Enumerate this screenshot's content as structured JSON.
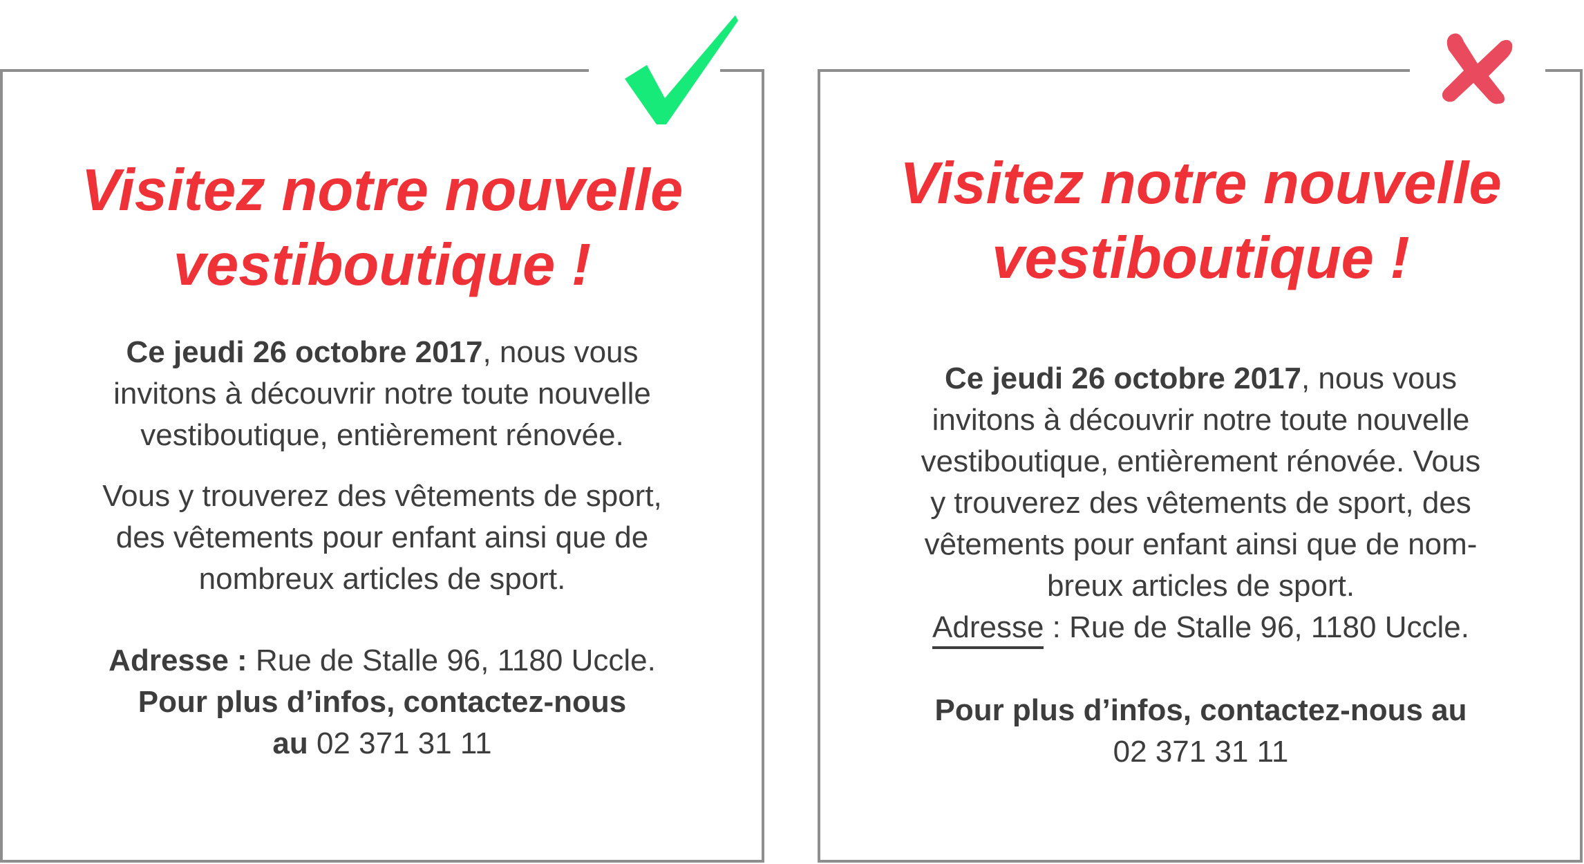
{
  "good_example": {
    "headline_line1": "Visitez notre nouvelle",
    "headline_line2": "vestiboutique !",
    "date_bold": "Ce jeudi 26 octobre 2017",
    "para1_rest": ", nous vous",
    "para1_line2": "invitons à découvrir notre toute nouvelle",
    "para1_line3": "vestiboutique, entièrement rénovée.",
    "para2_line1": "Vous y trouverez des vêtements de sport,",
    "para2_line2": "des vêtements pour enfant ainsi que de",
    "para2_line3": "nombreux articles de sport.",
    "address_label": "Adresse :",
    "address_value": " Rue de Stalle 96, 1180 Uccle.",
    "contact_line1": "Pour plus d’infos, contactez-nous",
    "contact_au": "au",
    "contact_phone": " 02 371 31 11"
  },
  "bad_example": {
    "headline_line1": "Visitez notre nouvelle",
    "headline_line2": "vestiboutique !",
    "date_bold": "Ce jeudi 26 octobre 2017",
    "para1_rest": ", nous vous",
    "line2": "invitons à découvrir notre toute nouvelle",
    "line3": "vestiboutique, entièrement rénovée. Vous",
    "line4": "y trouverez des vêtements de sport, des",
    "line5": "vêtements pour enfant ainsi que de nom-",
    "line6": "breux articles de sport.",
    "address_label": "Adresse",
    "address_value": " : Rue de Stalle 96, 1180 Uccle.",
    "contact_line1": "Pour plus d’infos, contactez-nous au",
    "contact_phone": "02 371 31 11"
  },
  "colors": {
    "headline": "#ee3238",
    "body": "#3d3d3d",
    "check": "#18ea7a",
    "cross": "#ea4a5e",
    "border": "#8e8e8e"
  },
  "icons": {
    "good": "checkmark-icon",
    "bad": "cross-icon"
  }
}
